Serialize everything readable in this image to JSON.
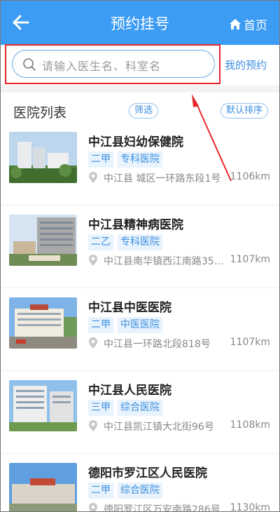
{
  "header": {
    "title": "预约挂号",
    "home_label": "首页",
    "accent": "#3c9cf4"
  },
  "search": {
    "placeholder": "请输入医生名、科室名",
    "my_reservation": "我的预约"
  },
  "list": {
    "title": "医院列表",
    "filter_label": "筛选",
    "sort_label": "默认排序"
  },
  "hospitals": [
    {
      "name": "中江县妇幼保健院",
      "level": "二甲",
      "type": "专科医院",
      "address": "中江县 城区一环路东段1号",
      "distance": "1106km",
      "image": "hospital-building-photo"
    },
    {
      "name": "中江县精神病医院",
      "level": "二乙",
      "type": "专科医院",
      "address": "中江县南华镇西江南路35…",
      "distance": "1107km",
      "image": "hospital-building-photo"
    },
    {
      "name": "中江县中医医院",
      "level": "二甲",
      "type": "中医医院",
      "address": "中江县一环路北段818号",
      "distance": "1107km",
      "image": "hospital-building-photo"
    },
    {
      "name": "中江县人民医院",
      "level": "三甲",
      "type": "综合医院",
      "address": "中江县凯江镇大北街96号",
      "distance": "1108km",
      "image": "hospital-building-photo"
    },
    {
      "name": "德阳市罗江区人民医院",
      "level": "二甲",
      "type": "综合医院",
      "address": "德阳罗江区万安南路286号",
      "distance": "1130km",
      "image": "hospital-building-photo"
    }
  ],
  "annotation_color": "#e8262b"
}
